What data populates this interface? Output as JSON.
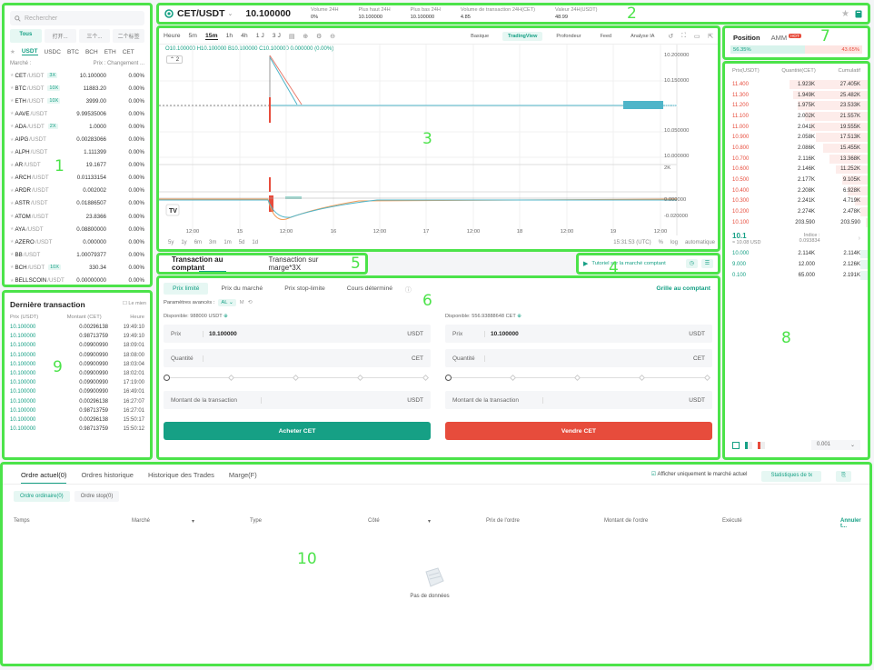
{
  "markets": {
    "search_placeholder": "Rechercher",
    "filters": [
      "Tous",
      "打开...",
      "三个...",
      "二个标签"
    ],
    "quotes": [
      "USDT",
      "USDC",
      "BTC",
      "BCH",
      "ETH",
      "CET"
    ],
    "col_market": "Marché :",
    "col_price_change": "Prix : Changement ...",
    "rows": [
      {
        "base": "CET",
        "quote": "/USDT",
        "lev": "3X",
        "price": "10.100000",
        "change": "0.00%"
      },
      {
        "base": "BTC",
        "quote": "/USDT",
        "lev": "10X",
        "price": "11883.20",
        "change": "0.00%"
      },
      {
        "base": "ETH",
        "quote": "/USDT",
        "lev": "10X",
        "price": "3999.00",
        "change": "0.00%"
      },
      {
        "base": "AAVE",
        "quote": "/USDT",
        "lev": "",
        "price": "9.99535006",
        "change": "0.00%"
      },
      {
        "base": "ADA",
        "quote": "/USDT",
        "lev": "2X",
        "price": "1.0000",
        "change": "0.00%"
      },
      {
        "base": "AIPG",
        "quote": "/USDT",
        "lev": "",
        "price": "0.00283066",
        "change": "0.00%"
      },
      {
        "base": "ALPH",
        "quote": "/USDT",
        "lev": "",
        "price": "1.111399",
        "change": "0.00%"
      },
      {
        "base": "AR",
        "quote": "/USDT",
        "lev": "",
        "price": "19.1677",
        "change": "0.00%"
      },
      {
        "base": "ARCH",
        "quote": "/USDT",
        "lev": "",
        "price": "0.01133154",
        "change": "0.00%"
      },
      {
        "base": "ARDR",
        "quote": "/USDT",
        "lev": "",
        "price": "0.002002",
        "change": "0.00%"
      },
      {
        "base": "ASTR",
        "quote": "/USDT",
        "lev": "",
        "price": "0.01886507",
        "change": "0.00%"
      },
      {
        "base": "ATOM",
        "quote": "/USDT",
        "lev": "",
        "price": "23.8366",
        "change": "0.00%"
      },
      {
        "base": "AYA",
        "quote": "/USDT",
        "lev": "",
        "price": "0.08800000",
        "change": "0.00%"
      },
      {
        "base": "AZERO",
        "quote": "/USDT",
        "lev": "",
        "price": "0.000000",
        "change": "0.00%"
      },
      {
        "base": "BB",
        "quote": "/USDT",
        "lev": "",
        "price": "1.00079377",
        "change": "0.00%"
      },
      {
        "base": "BCH",
        "quote": "/USDT",
        "lev": "10X",
        "price": "330.34",
        "change": "0.00%"
      },
      {
        "base": "BELLSCOIN",
        "quote": "/USDT",
        "lev": "",
        "price": "0.00000000",
        "change": "0.00%"
      }
    ]
  },
  "header": {
    "symbol": "CET/USDT",
    "price": "10.100000",
    "stats": [
      {
        "label": "Volume 24H",
        "value": "0%"
      },
      {
        "label": "Plus haut 24H",
        "value": "10.100000"
      },
      {
        "label": "Plus bas 24H",
        "value": "10.100000"
      },
      {
        "label": "Volume de transaction 24H(CET)",
        "value": "4.85"
      },
      {
        "label": "Valeur 24H(USDT)",
        "value": "48.99"
      }
    ]
  },
  "chart": {
    "intervals": [
      "Heure",
      "5m",
      "15m",
      "1h",
      "4h",
      "1 J",
      "3 J"
    ],
    "active_interval": "15m",
    "views": [
      "Basique",
      "TradingView",
      "Profondeur",
      "Feed",
      "Analyse IA"
    ],
    "active_view": "TradingView",
    "ohlc": "O10.100000 H10.100000 B10.100000 C10.100000 0.000000 (0.00%)",
    "indicator_count": "2",
    "price_axis": [
      "10.200000",
      "10.150000",
      "10.100000",
      "10.050000",
      "10.000000"
    ],
    "volume_axis": "2K",
    "macd_axis": [
      "0.000000",
      "-0.020000"
    ],
    "time_axis": [
      "12:00",
      "15",
      "12:00",
      "16",
      "12:00",
      "17",
      "12:00",
      "18",
      "12:00",
      "19",
      "12:00"
    ],
    "ranges": [
      "5y",
      "1y",
      "6m",
      "3m",
      "1m",
      "5d",
      "1d"
    ],
    "clock": "15:31:53 (UTC)",
    "opts": [
      "%",
      "log",
      "automatique"
    ]
  },
  "trade_tabs": {
    "spot": "Transaction au comptant",
    "margin": "Transaction sur marge*3X"
  },
  "tutorial": "Tutoriel sur la marché comptant",
  "order_form": {
    "types": [
      "Prix limité",
      "Prix du marché",
      "Prix stop-limite",
      "Cours déterminé"
    ],
    "grid_link": "Grille au comptant",
    "advanced_label": "Paramètres avancés :",
    "advanced_value": "AL",
    "advanced_m": "M",
    "buy": {
      "available": "Disponible: 988000",
      "avail_unit": "USDT",
      "price_label": "Prix",
      "price": "10.100000",
      "price_unit": "USDT",
      "qty_label": "Quantité",
      "qty_unit": "CET",
      "amount_label": "Montant de la transaction",
      "amount_unit": "USDT",
      "button": "Acheter CET"
    },
    "sell": {
      "available": "Disponible: 556.93888648",
      "avail_unit": "CET",
      "price_label": "Prix",
      "price": "10.100000",
      "price_unit": "USDT",
      "qty_label": "Quantité",
      "qty_unit": "CET",
      "amount_label": "Montant de la transaction",
      "amount_unit": "USDT",
      "button": "Vendre CET"
    }
  },
  "position": {
    "tab1": "Position",
    "tab2": "AMM",
    "hot": "HOT",
    "buy_pct": "56.35%",
    "sell_pct": "43.65%",
    "buy_ratio": 0.5635
  },
  "orderbook": {
    "headers": [
      "Prix(USDT)",
      "Quantité(CET)",
      "Cumulatif"
    ],
    "asks": [
      {
        "p": "11.400",
        "q": "1.923K",
        "c": "27.405K",
        "d": 0.55
      },
      {
        "p": "11.300",
        "q": "1.949K",
        "c": "25.482K",
        "d": 0.52
      },
      {
        "p": "11.200",
        "q": "1.975K",
        "c": "23.533K",
        "d": 0.49
      },
      {
        "p": "11.100",
        "q": "2.002K",
        "c": "21.557K",
        "d": 0.44
      },
      {
        "p": "11.000",
        "q": "2.041K",
        "c": "19.555K",
        "d": 0.4
      },
      {
        "p": "10.900",
        "q": "2.058K",
        "c": "17.513K",
        "d": 0.36
      },
      {
        "p": "10.800",
        "q": "2.086K",
        "c": "15.455K",
        "d": 0.31
      },
      {
        "p": "10.700",
        "q": "2.116K",
        "c": "13.368K",
        "d": 0.27
      },
      {
        "p": "10.600",
        "q": "2.146K",
        "c": "11.252K",
        "d": 0.22
      },
      {
        "p": "10.500",
        "q": "2.177K",
        "c": "9.105K",
        "d": 0.18
      },
      {
        "p": "10.400",
        "q": "2.208K",
        "c": "6.928K",
        "d": 0.14
      },
      {
        "p": "10.300",
        "q": "2.241K",
        "c": "4.719K",
        "d": 0.09
      },
      {
        "p": "10.200",
        "q": "2.274K",
        "c": "2.478K",
        "d": 0.05
      },
      {
        "p": "10.100",
        "q": "203.590",
        "c": "203.590",
        "d": 0.01
      }
    ],
    "last_price": "10.1",
    "last_usd": "≈ 10.08  USD",
    "index_label": "Indice :",
    "index_value": "0.093834",
    "bids": [
      {
        "p": "10.000",
        "q": "2.114K",
        "c": "2.114K",
        "d": 0.05
      },
      {
        "p": "9.000",
        "q": "12.000",
        "c": "2.126K",
        "d": 0.05
      },
      {
        "p": "0.100",
        "q": "65.000",
        "c": "2.191K",
        "d": 0.05
      }
    ],
    "precision": "0.001"
  },
  "latest": {
    "title": "Dernière transaction",
    "mine": "Le mien",
    "cols": [
      "Prix (USDT)",
      "Montant (CET)",
      "Heure"
    ],
    "rows": [
      {
        "p": "10.100000",
        "a": "0.00296138",
        "t": "19:49:10"
      },
      {
        "p": "10.100000",
        "a": "0.98713759",
        "t": "19:49:10"
      },
      {
        "p": "10.100000",
        "a": "0.09900990",
        "t": "18:09:01"
      },
      {
        "p": "10.100000",
        "a": "0.09900990",
        "t": "18:08:00"
      },
      {
        "p": "10.100000",
        "a": "0.09900990",
        "t": "18:03:04"
      },
      {
        "p": "10.100000",
        "a": "0.09900990",
        "t": "18:02:01"
      },
      {
        "p": "10.100000",
        "a": "0.09900990",
        "t": "17:19:00"
      },
      {
        "p": "10.100000",
        "a": "0.09900990",
        "t": "16:49:01"
      },
      {
        "p": "10.100000",
        "a": "0.00296138",
        "t": "16:27:07"
      },
      {
        "p": "10.100000",
        "a": "0.98713759",
        "t": "16:27:01"
      },
      {
        "p": "10.100000",
        "a": "0.00296138",
        "t": "15:50:17"
      },
      {
        "p": "10.100000",
        "a": "0.98713759",
        "t": "15:50:12"
      }
    ]
  },
  "orders": {
    "tabs": [
      "Ordre actuel(0)",
      "Ordres historique",
      "Historique des Trades",
      "Marge(F)"
    ],
    "only_current": "Afficher uniquement le marché actuel",
    "stats_btn": "Statistiques de tx",
    "types": [
      "Ordre ordinaire(0)",
      "Ordre stop(0)"
    ],
    "cols": [
      "Temps",
      "Marché",
      "Type",
      "Côté",
      "Prix de l'ordre",
      "Montant de l'ordre",
      "Exécuté"
    ],
    "cancel_all": "Annuler t...",
    "empty": "Pas de données"
  },
  "annotations": [
    "1",
    "2",
    "3",
    "4",
    "5",
    "6",
    "7",
    "8",
    "9",
    "10"
  ]
}
